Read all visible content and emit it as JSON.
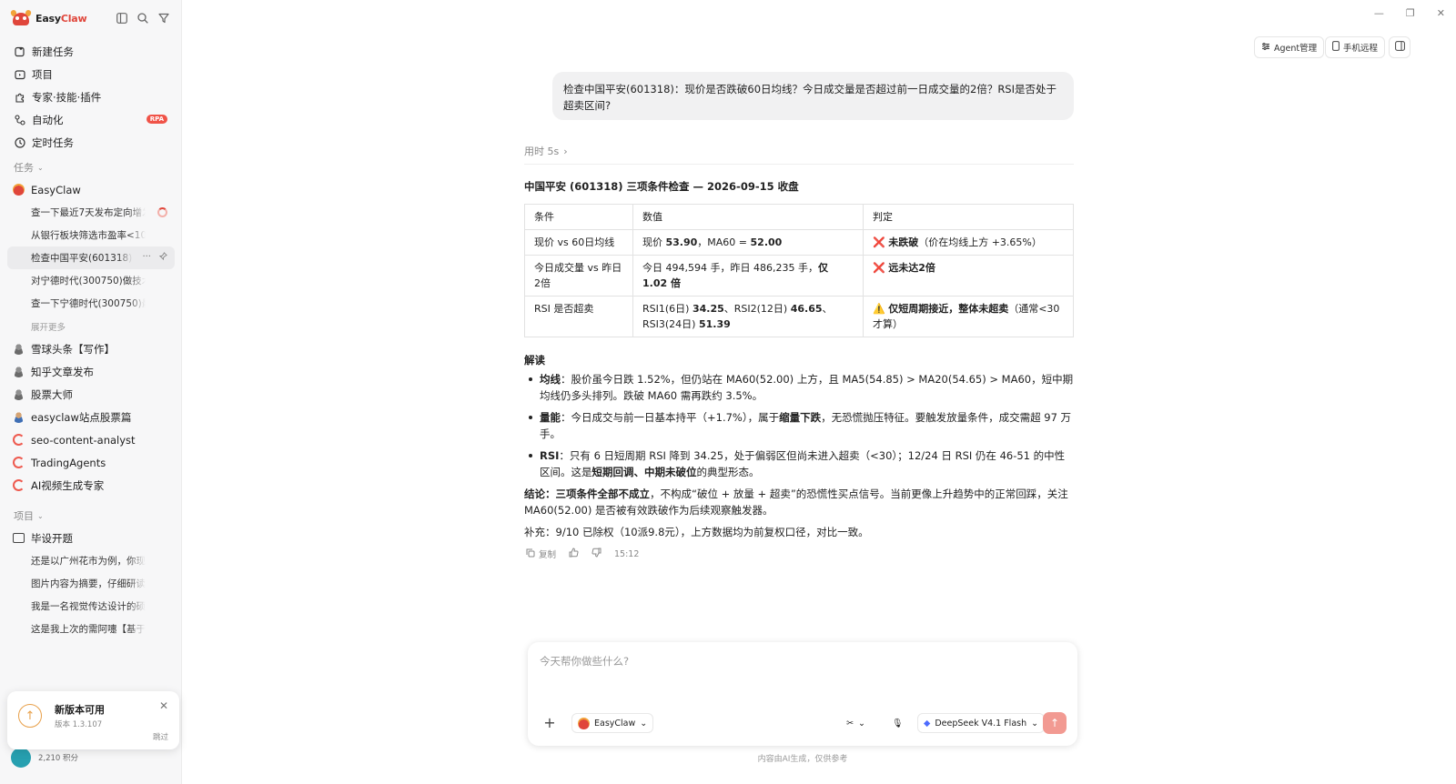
{
  "app": {
    "name_part1": "Easy",
    "name_part2": "Claw"
  },
  "nav": [
    {
      "label": "新建任务"
    },
    {
      "label": "项目"
    },
    {
      "label": "专家·技能·插件"
    },
    {
      "label": "自动化",
      "badge": "RPA"
    },
    {
      "label": "定时任务"
    }
  ],
  "sections": {
    "tasks": "任务",
    "projects": "项目"
  },
  "tasks": {
    "group": "EasyClaw",
    "items": [
      "查一下最近7天发布定向增发公告的公司",
      "从银行板块筛选市盈率<10、近2年",
      "检查中国平安(601318)：现价是否",
      "对宁德时代(300750)做技术分析",
      "查一下宁德时代(300750)最近20个交易日"
    ],
    "more": "展开更多",
    "agents": [
      "雪球头条【写作】",
      "知乎文章发布",
      "股票大师",
      "easyclaw站点股票篇",
      "seo-content-analyst",
      "TradingAgents",
      "AI视频生成专家"
    ]
  },
  "projects": {
    "folder": "毕设开题",
    "items": [
      "还是以广州花市为例，你现在要做",
      "图片内容为摘要，仔细研读，仿照",
      "我是一名视觉传达设计的硕士研究生",
      "这是我上次的需阿嚏【基于皮尔斯"
    ]
  },
  "update": {
    "title": "新版本可用",
    "version": "版本 1.3.107",
    "skip": "跳过"
  },
  "credits": "2,210 积分",
  "topbar": {
    "agent": "Agent管理",
    "phone": "手机远程"
  },
  "user_message": "检查中国平安(601318)：现价是否跌破60日均线？今日成交量是否超过前一日成交量的2倍？RSI是否处于超卖区间?",
  "elapsed": "用时 5s",
  "answer": {
    "title": "中国平安 (601318) 三项条件检查 — 2026-09-15 收盘",
    "headers": [
      "条件",
      "数值",
      "判定"
    ],
    "rows": [
      {
        "cond": "现价 vs 60日均线",
        "v1": "现价 ",
        "v1b": "53.90",
        "v2": "，MA60 = ",
        "v2b": "52.00",
        "v3": "",
        "j_mark": "❌",
        "j_bold": "未跌破",
        "j_rest": "（价在均线上方 +3.65%）"
      },
      {
        "cond": "今日成交量 vs 昨日2倍",
        "v1": "今日 494,594 手，昨日 486,235 手，",
        "v1b": "仅 1.02 倍",
        "v2": "",
        "v2b": "",
        "v3": "",
        "j_mark": "❌",
        "j_bold": "远未达2倍",
        "j_rest": ""
      },
      {
        "cond": "RSI 是否超卖",
        "v1": "RSI1(6日) ",
        "v1b": "34.25",
        "v2": "、RSI2(12日) ",
        "v2b": "46.65",
        "v3": "、RSI3(24日) ",
        "v3b": "51.39",
        "j_mark": "⚠️",
        "j_bold": "仅短周期接近，整体未超卖",
        "j_rest": "（通常<30才算）"
      }
    ],
    "interp_title": "解读",
    "bullets": [
      {
        "k": "均线",
        "t": "：股价虽今日跌 1.52%，但仍站在 MA60(52.00) 上方，且 MA5(54.85) > MA20(54.65) > MA60，短中期均线仍多头排列。跌破 MA60 需再跌约 3.5%。"
      },
      {
        "k": "量能",
        "t1": "：今日成交与前一日基本持平（+1.7%），属于",
        "tb": "缩量下跌",
        "t2": "，无恐慌抛压特征。要触发放量条件，成交需超 97 万手。"
      },
      {
        "k": "RSI",
        "t1": "：只有 6 日短周期 RSI 降到 34.25，处于偏弱区但尚未进入超卖（<30）；12/24 日 RSI 仍在 46-51 的中性区间。这是",
        "tb": "短期回调、中期未破位",
        "t2": "的典型形态。"
      }
    ],
    "conclusion_k": "结论：",
    "conclusion_b": "三项条件全部不成立",
    "conclusion_t": "，不构成“破位 + 放量 + 超卖”的恐慌性买点信号。当前更像上升趋势中的正常回踩，关注 MA60(52.00) 是否被有效跌破作为后续观察触发器。",
    "note": "补充：9/10 已除权（10派9.8元），上方数据均为前复权口径，对比一致。"
  },
  "msg_actions": {
    "copy": "复制",
    "time": "15:12"
  },
  "composer": {
    "placeholder": "今天帮你做些什么?",
    "agent": "EasyClaw",
    "model": "DeepSeek V4.1 Flash"
  },
  "disclaimer": "内容由AI生成，仅供参考"
}
